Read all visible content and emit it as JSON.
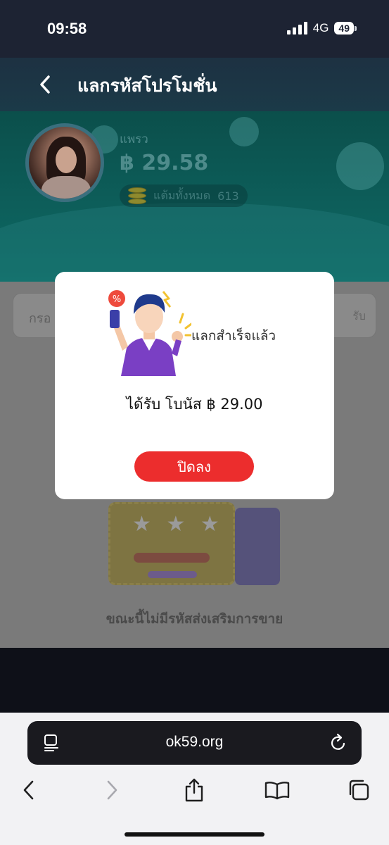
{
  "status_bar": {
    "time": "09:58",
    "network": "4G",
    "battery": "49"
  },
  "header": {
    "back_icon": "chevron-left-icon",
    "title": "แลกรหัสโปรโมชั่น"
  },
  "profile": {
    "name": "แพรว",
    "balance": "฿ 29.58",
    "points_label": "แต้มทั้งหมด",
    "points_value": "613",
    "points_icon": "coin-stack-icon"
  },
  "promo_input": {
    "placeholder_visible": "กรอ",
    "button_partial": "รับ"
  },
  "empty_state": {
    "icon": "ticket-icon",
    "message": "ขณะนี้ไม่มีรหัสส่งเสริมการขาย"
  },
  "modal": {
    "illustration": "excited-man-phone-illustration",
    "status": "แลกสำเร็จแล้ว",
    "reward": "ได้รับ โบนัส ฿ 29.00",
    "close_button": "ปิดลง",
    "button_color": "#ec2d2d"
  },
  "browser": {
    "url": "ok59.org",
    "page_icon": "page-menu-icon",
    "reload_icon": "reload-icon",
    "toolbar": [
      "back-icon",
      "forward-icon",
      "share-icon",
      "bookmarks-icon",
      "tabs-icon"
    ]
  }
}
